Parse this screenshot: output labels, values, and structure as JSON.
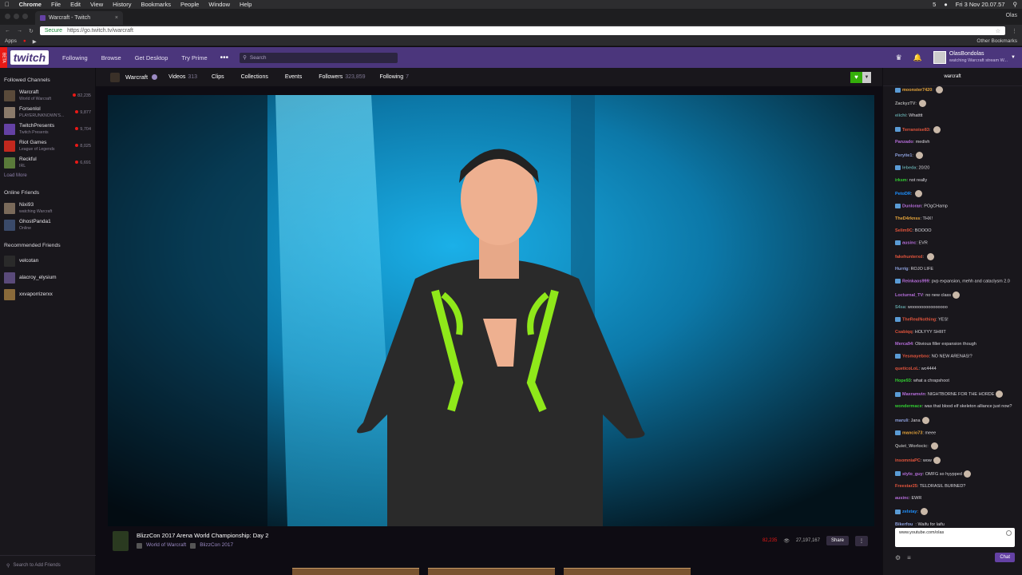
{
  "macbar": {
    "app": "Chrome",
    "menus": [
      "File",
      "Edit",
      "View",
      "History",
      "Bookmarks",
      "People",
      "Window",
      "Help"
    ],
    "clock": "Fri 3 Nov  20.07.57",
    "badge": "5"
  },
  "browser": {
    "tab_title": "Warcraft - Twitch",
    "user": "Olas",
    "secure": "Secure",
    "url": "https://go.twitch.tv/warcraft",
    "apps": "Apps",
    "other_bookmarks": "Other Bookmarks"
  },
  "topnav": {
    "beta": "BETA",
    "logo": "twitch",
    "links": [
      "Following",
      "Browse",
      "Get Desktop",
      "Try Prime"
    ],
    "search_placeholder": "Search",
    "user_name": "OlasBondolas",
    "user_status": "watching Warcraft stream W..."
  },
  "sidebar": {
    "followed_header": "Followed Channels",
    "followed": [
      {
        "name": "Warcraft",
        "game": "World of Warcraft",
        "viewers": "82,235",
        "color": "#5a4a3a"
      },
      {
        "name": "Forsenlol",
        "game": "PLAYERUNKNOWN'S...",
        "viewers": "9,877",
        "color": "#8a7a6a"
      },
      {
        "name": "TwitchPresents",
        "game": "Twitch Presents",
        "viewers": "9,704",
        "color": "#6441a4"
      },
      {
        "name": "Riot Games",
        "game": "League of Legends",
        "viewers": "8,025",
        "color": "#c2281e"
      },
      {
        "name": "Reckful",
        "game": "IRL",
        "viewers": "6,691",
        "color": "#5a7a3a"
      }
    ],
    "load_more": "Load More",
    "friends_header": "Online Friends",
    "friends": [
      {
        "name": "Nixi93",
        "status": "watching Warcraft",
        "color": "#7a6a5a"
      },
      {
        "name": "GhostPanda1",
        "status": "Online",
        "color": "#3a4a6a"
      }
    ],
    "recommended_header": "Recommended Friends",
    "recommended": [
      {
        "name": "velcotan",
        "color": "#2a2a2a"
      },
      {
        "name": "alacroy_elysium",
        "color": "#5a4a7a"
      },
      {
        "name": "xxvaporrizerxx",
        "color": "#8a6a3a"
      }
    ],
    "search_friends": "Search to Add Friends"
  },
  "channel": {
    "name": "Warcraft",
    "tabs": [
      {
        "label": "Videos",
        "count": "313"
      },
      {
        "label": "Clips",
        "count": ""
      },
      {
        "label": "Collections",
        "count": ""
      },
      {
        "label": "Events",
        "count": ""
      },
      {
        "label": "Followers",
        "count": "323,859"
      },
      {
        "label": "Following",
        "count": "7"
      }
    ]
  },
  "stream": {
    "title": "BlizzCon 2017 Arena World Championship: Day 2",
    "game": "World of Warcraft",
    "community": "BlizzCon 2017",
    "live_viewers": "82,235",
    "total_views": "27,197,167",
    "share": "Share",
    "more": "⋮"
  },
  "chat": {
    "room": "warcraft",
    "messages": [
      {
        "user": "moonster7420",
        "color": "#e4a43b",
        "text": "",
        "emote": true
      },
      {
        "user": "ZackyzTV",
        "color": "#a9a9a9",
        "text": "",
        "emote": true
      },
      {
        "user": "eiichi",
        "color": "#5f9ea0",
        "text": "Whatttt",
        "emote": false
      },
      {
        "user": "Terranoise83",
        "color": "#e0543c",
        "text": "",
        "emote": true
      },
      {
        "user": "Panzado",
        "color": "#b46dd8",
        "text": "medivh",
        "emote": false
      },
      {
        "user": "Peryite1",
        "color": "#8c9fdb",
        "text": "",
        "emote": true
      },
      {
        "user": "lebeda",
        "color": "#5f9ea0",
        "text": "20/20",
        "emote": false
      },
      {
        "user": "irksm",
        "color": "#32cd32",
        "text": "not really",
        "emote": false
      },
      {
        "user": "PetoDR",
        "color": "#1e90ff",
        "text": "",
        "emote": true
      },
      {
        "user": "Dunloran",
        "color": "#b46dd8",
        "text": "POgCHamp",
        "emote": false
      },
      {
        "user": "TheD4rknss",
        "color": "#e4a43b",
        "text": "THX!",
        "emote": false
      },
      {
        "user": "Selim9C",
        "color": "#e0543c",
        "text": "BOOOO",
        "emote": false
      },
      {
        "user": "ausinc",
        "color": "#b46dd8",
        "text": "EVR",
        "emote": false
      },
      {
        "user": "fakehunterxd",
        "color": "#e0543c",
        "text": "",
        "emote": true
      },
      {
        "user": "Hurrig",
        "color": "#8c9fdb",
        "text": "ROJO LIFE",
        "emote": false
      },
      {
        "user": "Reinkaos999",
        "color": "#b46dd8",
        "text": "pvp expansion, mehh and cataclysm 2.0",
        "emote": false
      },
      {
        "user": "Locturnal_TV",
        "color": "#b46dd8",
        "text": "no new class",
        "emote": true
      },
      {
        "user": "S4sa",
        "color": "#5f9ea0",
        "text": "wooooooooooooooo",
        "emote": false
      },
      {
        "user": "TheRealNothing",
        "color": "#e0543c",
        "text": "YES!",
        "emote": false
      },
      {
        "user": "Csabiqq",
        "color": "#e0543c",
        "text": "HOLYYY SHIIIT",
        "emote": false
      },
      {
        "user": "Merca94",
        "color": "#b46dd8",
        "text": "Obvious filler expansion though",
        "emote": false
      },
      {
        "user": "Yesmayebno",
        "color": "#e0543c",
        "text": "NO NEW ARENAS!?",
        "emote": false
      },
      {
        "user": "queticoLoL",
        "color": "#e0543c",
        "text": "wc4444",
        "emote": false
      },
      {
        "user": "Hope93",
        "color": "#32cd32",
        "text": "what a chrapshoot",
        "emote": false
      },
      {
        "user": "Maxramvin",
        "color": "#b46dd8",
        "text": "NIGHTBORNE FOR THE HORDE",
        "emote": true
      },
      {
        "user": "wondermace",
        "color": "#32cd32",
        "text": "was that blood elf skeleton alliance just now?",
        "emote": false
      },
      {
        "user": "maruli",
        "color": "#8c9fdb",
        "text": "Jana",
        "emote": true
      },
      {
        "user": "mancio73",
        "color": "#e4a43b",
        "text": "meee",
        "emote": false
      },
      {
        "user": "Quiet_Worlocic",
        "color": "#a9a9a9",
        "text": "",
        "emote": true
      },
      {
        "user": "insomniaPC",
        "color": "#e0543c",
        "text": "wow",
        "emote": true
      },
      {
        "user": "stylo_guy",
        "color": "#b46dd8",
        "text": "OMFG so hyypped",
        "emote": true
      },
      {
        "user": "Freestar25",
        "color": "#e0543c",
        "text": "TELDRASIL BURNED?",
        "emote": false
      },
      {
        "user": "ausinc",
        "color": "#b46dd8",
        "text": "EWR",
        "emote": false
      },
      {
        "user": "zelstay",
        "color": "#1e90ff",
        "text": "",
        "emote": true
      },
      {
        "user": "Bikerfou_",
        "color": "#8c9fdb",
        "text": "Waifu for laifu",
        "emote": false
      }
    ],
    "input_value": "www.youtube.com/olas",
    "chat_button": "Chat"
  }
}
